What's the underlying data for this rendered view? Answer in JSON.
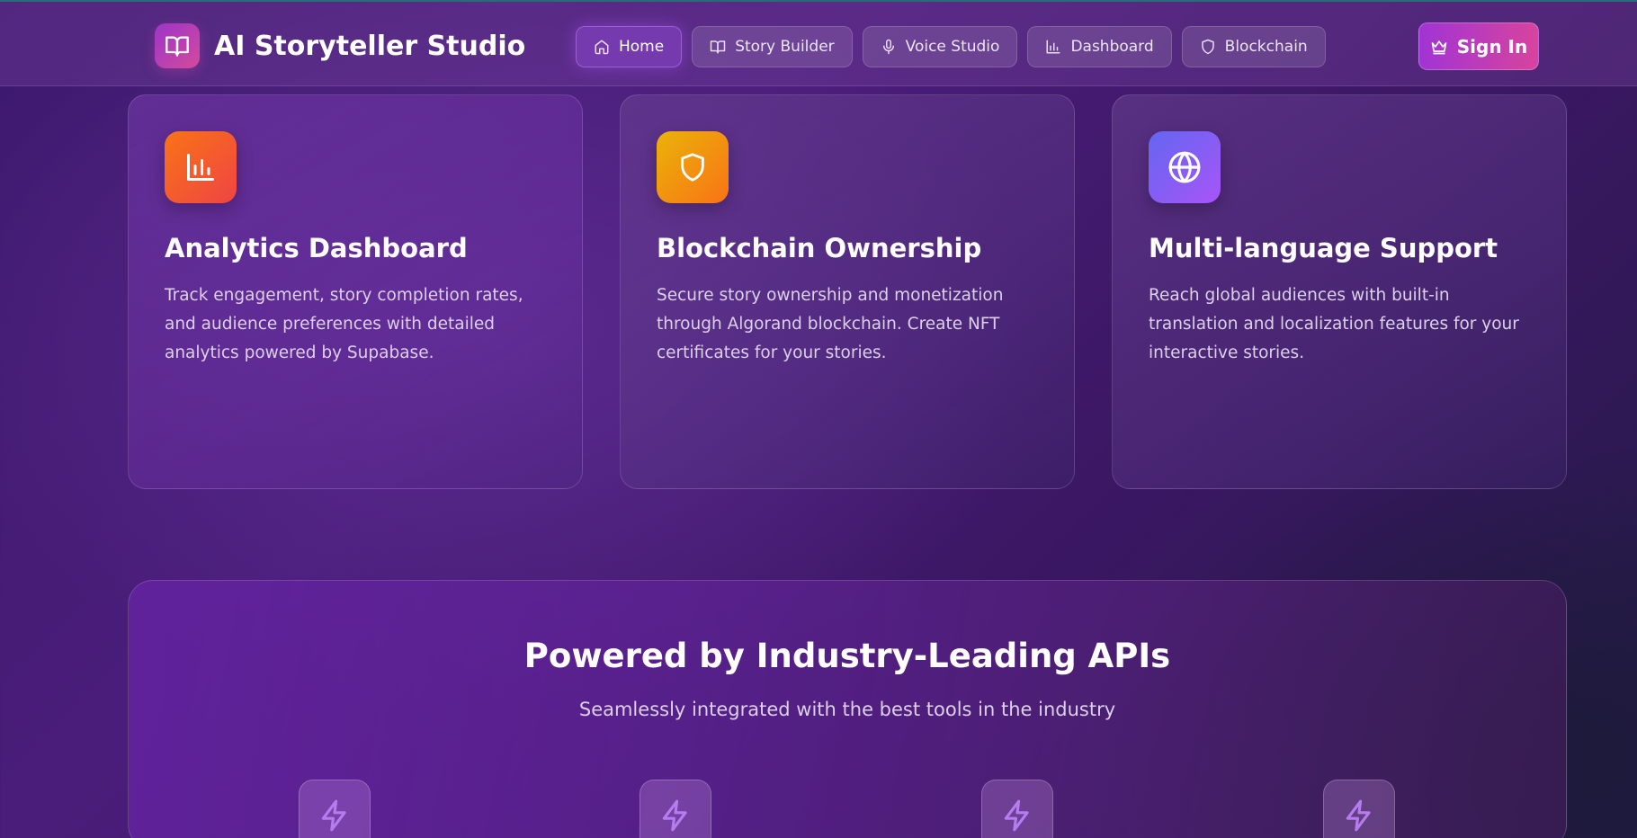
{
  "header": {
    "brand_title": "AI Storyteller Studio",
    "brand_icon": "book-open-icon",
    "nav": [
      {
        "label": "Home",
        "icon": "home-icon",
        "active": true
      },
      {
        "label": "Story Builder",
        "icon": "book-open-icon",
        "active": false
      },
      {
        "label": "Voice Studio",
        "icon": "microphone-icon",
        "active": false
      },
      {
        "label": "Dashboard",
        "icon": "bar-chart-icon",
        "active": false
      },
      {
        "label": "Blockchain",
        "icon": "shield-icon",
        "active": false
      }
    ],
    "signin_label": "Sign In",
    "signin_icon": "crown-icon"
  },
  "features": [
    {
      "title": "Analytics Dashboard",
      "description": "Track engagement, story completion rates, and audience preferences with detailed analytics powered by Supabase.",
      "icon": "bar-chart-icon",
      "gradient": [
        "#f97316",
        "#ef4444"
      ]
    },
    {
      "title": "Blockchain Ownership",
      "description": "Secure story ownership and monetization through Algorand blockchain. Create NFT certificates for your stories.",
      "icon": "shield-icon",
      "gradient": [
        "#eab308",
        "#f97316"
      ]
    },
    {
      "title": "Multi-language Support",
      "description": "Reach global audiences with built-in translation and localization features for your interactive stories.",
      "icon": "globe-icon",
      "gradient": [
        "#6366f1",
        "#a855f7"
      ]
    }
  ],
  "apis": {
    "title": "Powered by Industry-Leading APIs",
    "subtitle": "Seamlessly integrated with the best tools in the industry",
    "tiles": [
      {
        "icon": "lightning-icon"
      },
      {
        "icon": "lightning-icon"
      },
      {
        "icon": "lightning-icon"
      },
      {
        "icon": "lightning-icon"
      }
    ]
  },
  "colors": {
    "accent_purple": "#a855f7",
    "signin_gradient_start": "#a134d4",
    "signin_gradient_end": "#d8439e",
    "lightning_icon": "#b57cf0"
  }
}
